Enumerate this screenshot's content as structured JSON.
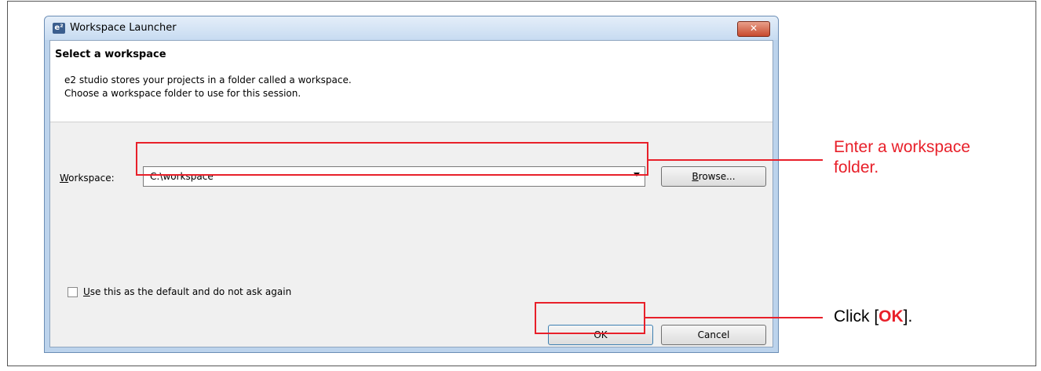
{
  "window": {
    "title": "Workspace Launcher",
    "app_icon_text": "e²",
    "close_label": "✕"
  },
  "header": {
    "title": "Select a workspace",
    "desc_line1": "e2 studio stores your projects in a folder called a workspace.",
    "desc_line2": "Choose a workspace folder to use for this session."
  },
  "workspace": {
    "label": "Workspace:",
    "value": "C:\\workspace",
    "browse_label": "Browse..."
  },
  "default_checkbox": {
    "label": "Use this as the default and do not ask again",
    "checked": false
  },
  "buttons": {
    "ok_label": "OK",
    "cancel_label": "Cancel"
  },
  "annotations": {
    "workspace_line1": "Enter a workspace",
    "workspace_line2": "folder.",
    "ok_prefix": "Click [",
    "ok_bold": "OK",
    "ok_suffix": "]."
  },
  "colors": {
    "highlight": "#e8202a",
    "title_bar": "#c7dbf1",
    "dialog_bg": "#f0f0f0"
  }
}
